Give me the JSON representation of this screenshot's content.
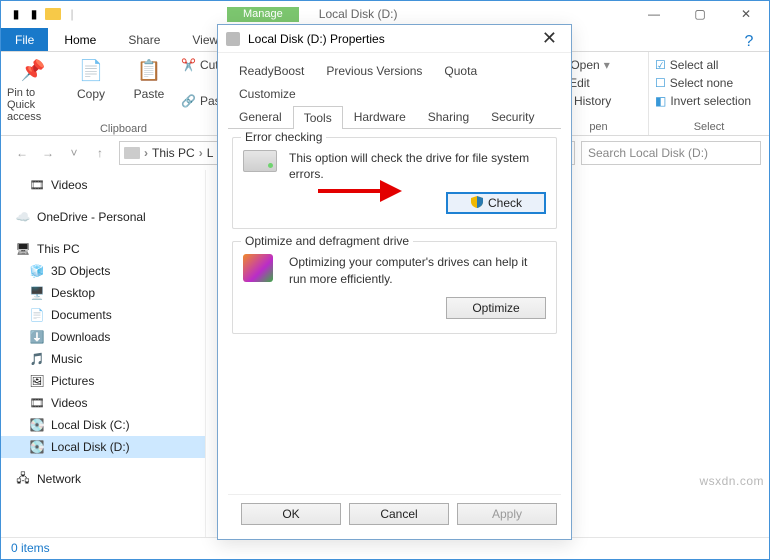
{
  "explorer": {
    "title": "Local Disk (D:)",
    "manage_tab": "Manage",
    "tabs": {
      "file": "File",
      "home": "Home",
      "share": "Share",
      "view": "View"
    },
    "ribbon": {
      "pin": "Pin to Quick access",
      "copy": "Copy",
      "paste": "Paste",
      "cut": "Cut",
      "paste_s": "Paste s",
      "clipboard": "Clipboard",
      "open_menu": "Open",
      "edit": "Edit",
      "history": "History",
      "pen": "pen",
      "select_all": "Select all",
      "select_none": "Select none",
      "invert": "Invert selection",
      "select": "Select"
    },
    "breadcrumb": {
      "pc": "This PC",
      "drive": "L"
    },
    "search_placeholder": "Search Local Disk (D:)",
    "tree": [
      {
        "icon": "video",
        "label": "Videos"
      },
      {
        "icon": "cloud",
        "label": "OneDrive - Personal",
        "top": true
      },
      {
        "icon": "pc",
        "label": "This PC",
        "top": true
      },
      {
        "icon": "cube3d",
        "label": "3D Objects"
      },
      {
        "icon": "desktop",
        "label": "Desktop"
      },
      {
        "icon": "doc",
        "label": "Documents"
      },
      {
        "icon": "down",
        "label": "Downloads"
      },
      {
        "icon": "music",
        "label": "Music"
      },
      {
        "icon": "pic",
        "label": "Pictures"
      },
      {
        "icon": "video",
        "label": "Videos"
      },
      {
        "icon": "drive",
        "label": "Local Disk (C:)"
      },
      {
        "icon": "drive",
        "label": "Local Disk (D:)",
        "sel": true
      },
      {
        "icon": "net",
        "label": "Network",
        "top": true
      }
    ],
    "status": "0 items"
  },
  "dialog": {
    "title": "Local Disk (D:) Properties",
    "tabs_row1": [
      "ReadyBoost",
      "Previous Versions",
      "Quota",
      "Customize"
    ],
    "tabs_row2": [
      "General",
      "Tools",
      "Hardware",
      "Sharing",
      "Security"
    ],
    "active_tab": "Tools",
    "group1": {
      "legend": "Error checking",
      "text": "This option will check the drive for file system errors.",
      "button": "Check"
    },
    "group2": {
      "legend": "Optimize and defragment drive",
      "text": "Optimizing your computer's drives can help it run more efficiently.",
      "button": "Optimize"
    },
    "footer": {
      "ok": "OK",
      "cancel": "Cancel",
      "apply": "Apply"
    }
  },
  "watermark": "wsxdn.com"
}
